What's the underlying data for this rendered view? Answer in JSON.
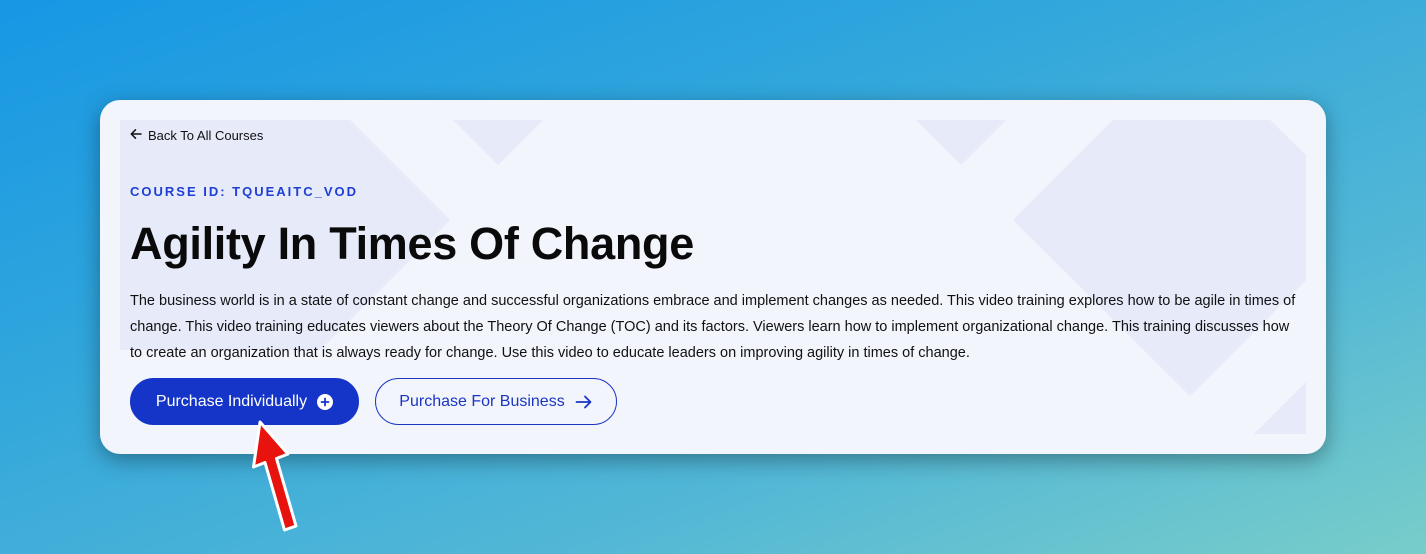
{
  "back_link": {
    "label": "Back To All Courses",
    "icon": "arrow-left-icon"
  },
  "course": {
    "id_label": "COURSE ID: TQUEAITC_VOD",
    "title": "Agility In Times Of Change",
    "description": "The business world is in a state of constant change and successful organizations embrace and implement changes as needed. This video training explores how to be agile in times of change. This video training educates viewers about the Theory Of Change (TOC) and its factors. Viewers learn how to implement organizational change. This training discusses how to create an organization that is always ready for change. Use this video to educate leaders on improving agility in times of change."
  },
  "buttons": {
    "purchase_individually": {
      "label": "Purchase Individually",
      "icon": "plus-circle-icon"
    },
    "purchase_business": {
      "label": "Purchase For Business",
      "icon": "arrow-right-icon"
    }
  },
  "colors": {
    "accent": "#1535c9",
    "card_background": "#f3f5fd",
    "annotation_arrow": "#e8130f"
  }
}
